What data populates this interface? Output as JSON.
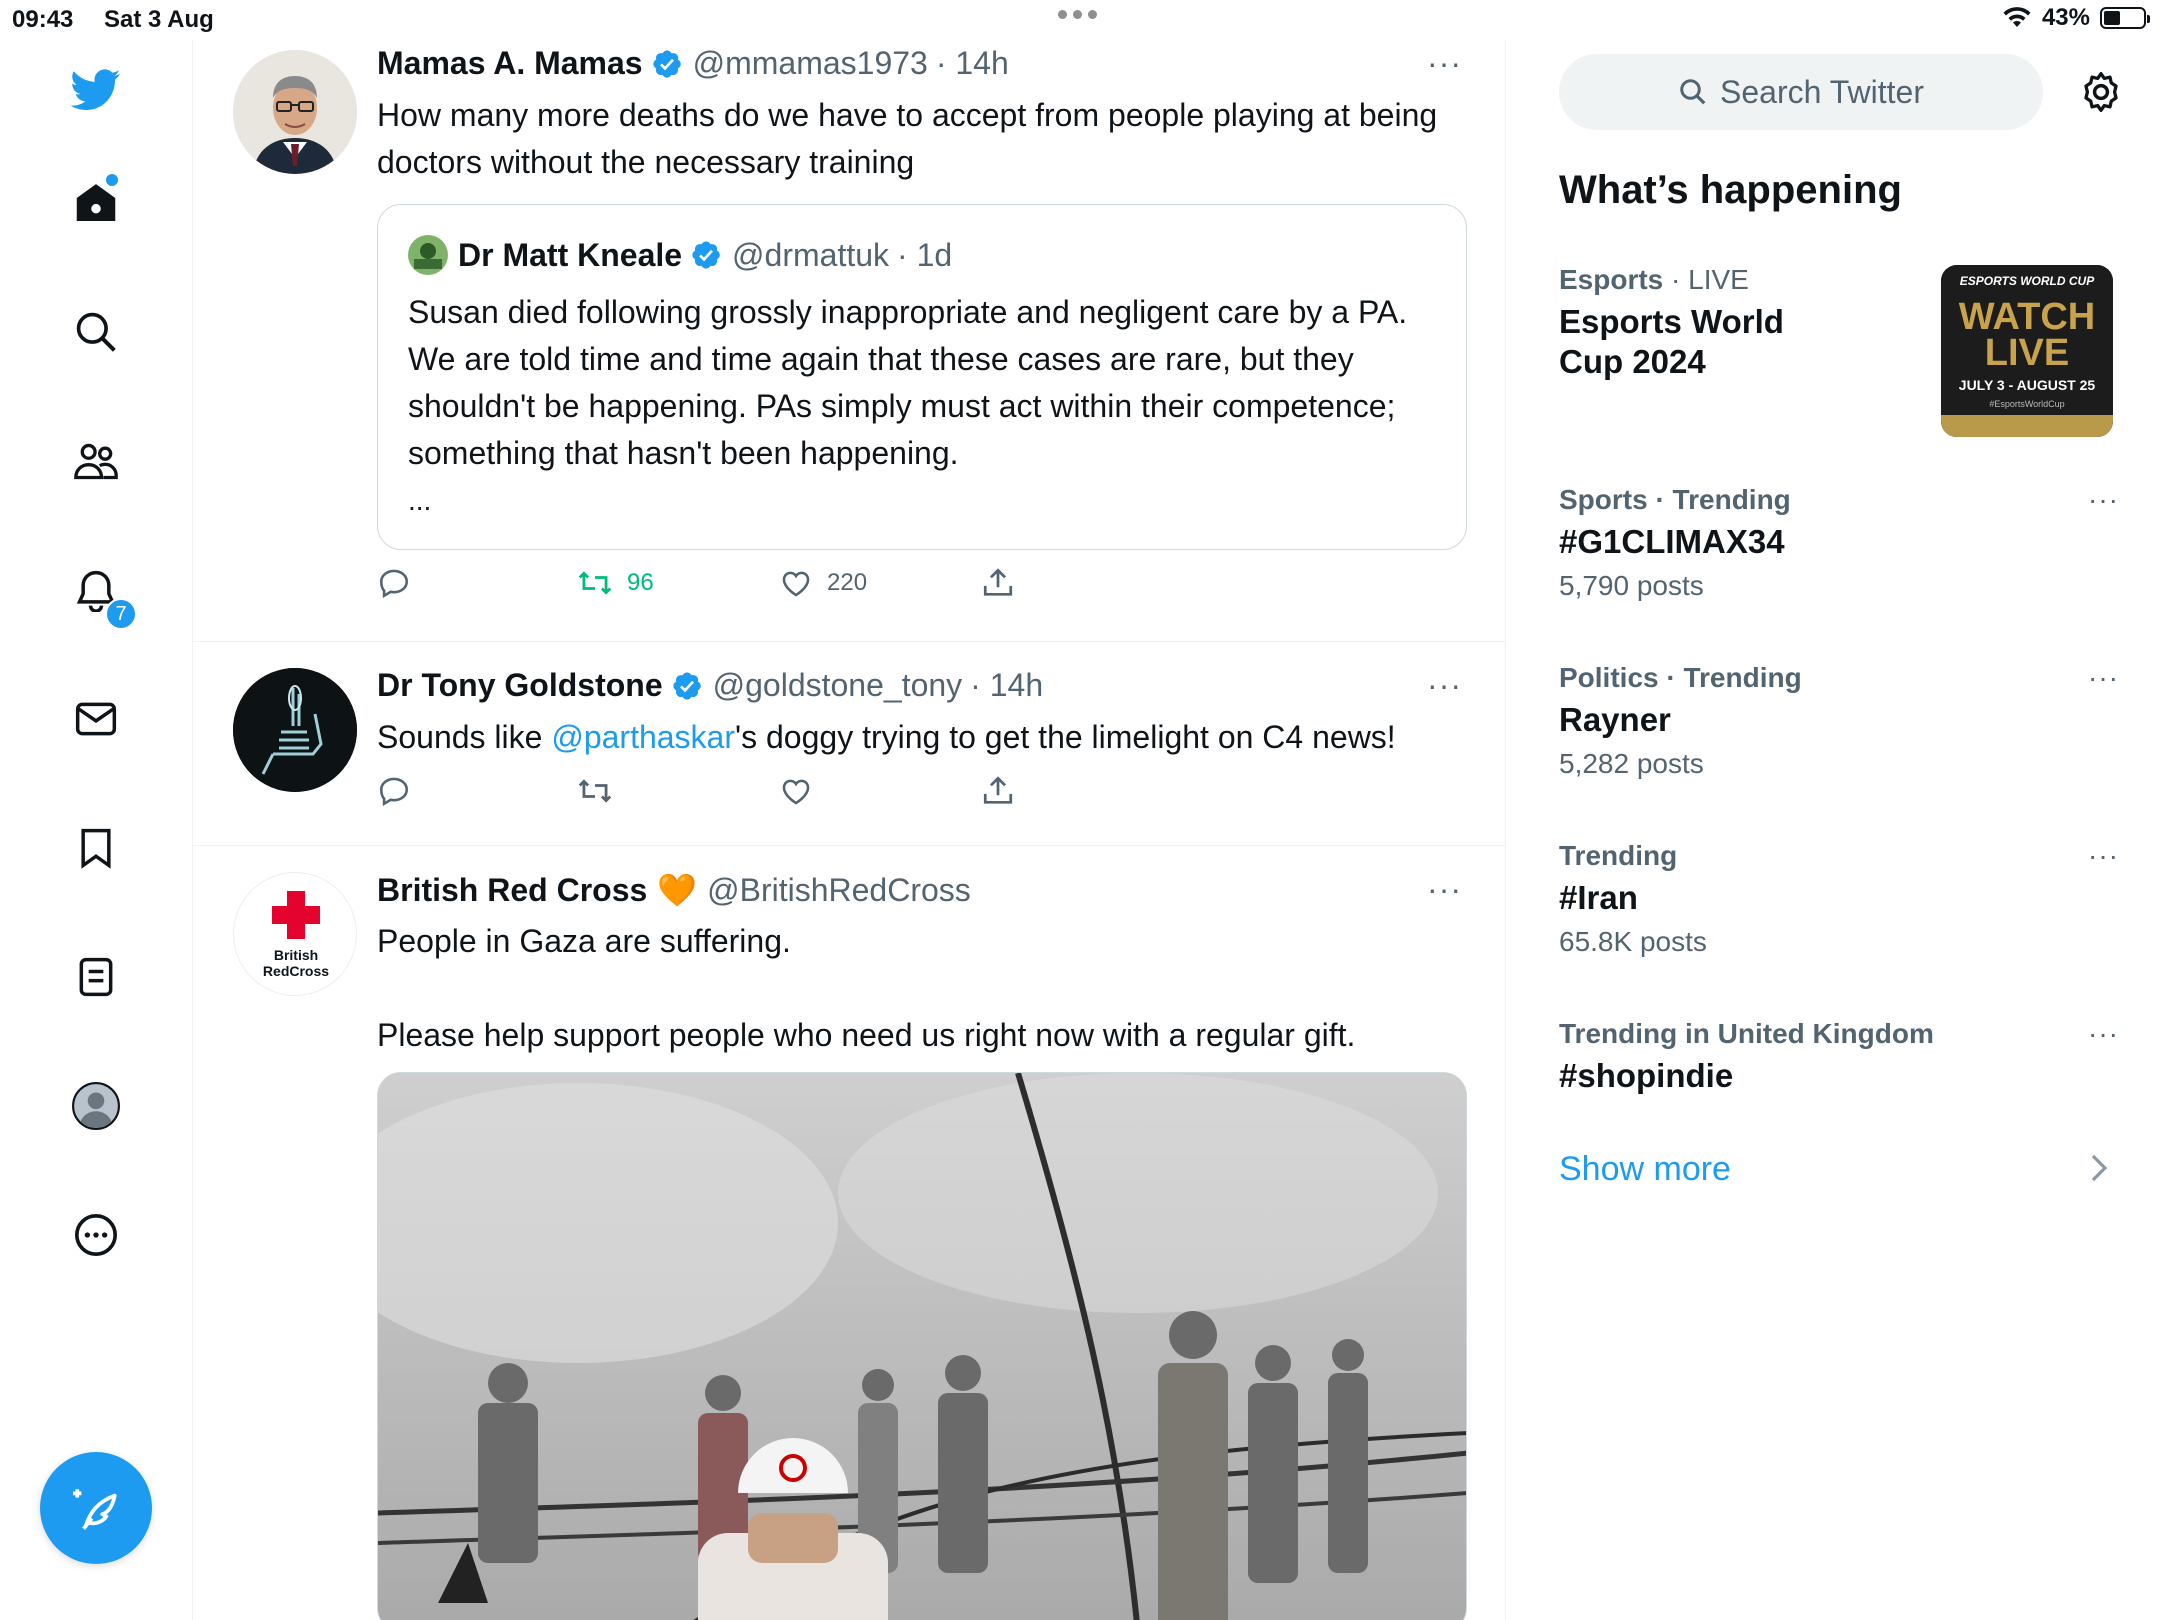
{
  "status_bar": {
    "time": "09:43",
    "date": "Sat 3 Aug",
    "battery": "43%",
    "battery_level": 0.43
  },
  "nav": {
    "notifications_badge": "7"
  },
  "tweets": [
    {
      "name": "Mamas A. Mamas",
      "handle": "@mmamas1973",
      "time": "· 14h",
      "text": "How many more deaths do we have to accept from people playing at being doctors without the necessary training",
      "quote": {
        "name": "Dr Matt Kneale",
        "handle": "@drmattuk",
        "time": "· 1d",
        "text": "Susan died following grossly inappropriate and negligent care by a PA. We are told time and time again that these cases are rare, but they shouldn't be happening. PAs simply must act within their competence; something that hasn't been happening.",
        "ellipsis": "..."
      },
      "retweets": "96",
      "likes": "220"
    },
    {
      "name": "Dr Tony Goldstone",
      "handle": "@goldstone_tony",
      "time": "· 14h",
      "text_before": "Sounds like ",
      "mention": "@parthaskar",
      "text_after": "'s doggy trying to get the limelight on C4 news!"
    },
    {
      "name": "British Red Cross",
      "emoji": "🧡",
      "handle": "@BritishRedCross",
      "text": "People in Gaza are suffering.\n\nPlease help support people who need us right now with a regular gift.",
      "avatar_text_1": "British",
      "avatar_text_2": "RedCross"
    }
  ],
  "sidebar": {
    "search_placeholder": "Search Twitter",
    "title": "What’s happening",
    "trends": [
      {
        "category": "Esports",
        "status": "· LIVE",
        "title": "Esports World Cup 2024",
        "image_top": "ESPORTS WORLD CUP",
        "image_main": "WATCH LIVE",
        "image_dates": "JULY 3 - AUGUST 25",
        "image_tag": "#EsportsWorldCup"
      },
      {
        "meta": "Sports · Trending",
        "title": "#G1CLIMAX34",
        "count": "5,790 posts"
      },
      {
        "meta": "Politics · Trending",
        "title": "Rayner",
        "count": "5,282 posts"
      },
      {
        "meta": "Trending",
        "title": "#Iran",
        "count": "65.8K posts"
      },
      {
        "meta": "Trending in United Kingdom",
        "title": "#shopindie"
      }
    ],
    "show_more": "Show more"
  },
  "colors": {
    "accent": "#1d9bf0",
    "retweet_green": "#00ba7c",
    "muted": "#536471",
    "red_cross": "#e4032e"
  }
}
